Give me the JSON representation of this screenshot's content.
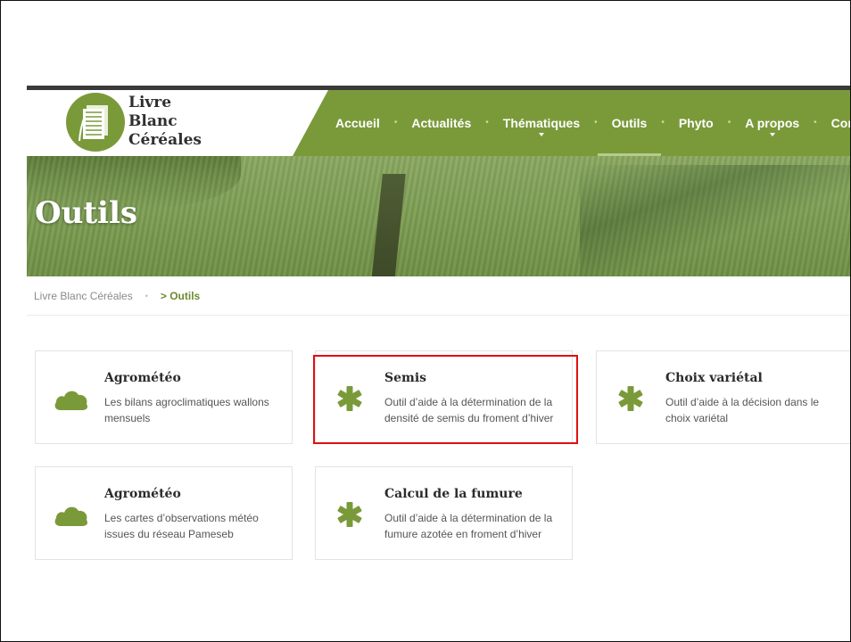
{
  "logo": {
    "lines": [
      "Livre",
      "Blanc",
      "Céréales"
    ]
  },
  "nav": {
    "items": [
      {
        "label": "Accueil",
        "dropdown": false,
        "active": false
      },
      {
        "label": "Actualités",
        "dropdown": false,
        "active": false
      },
      {
        "label": "Thématiques",
        "dropdown": true,
        "active": false
      },
      {
        "label": "Outils",
        "dropdown": false,
        "active": true
      },
      {
        "label": "Phyto",
        "dropdown": false,
        "active": false
      },
      {
        "label": "A propos",
        "dropdown": true,
        "active": false
      },
      {
        "label": "Contact",
        "dropdown": false,
        "active": false
      }
    ]
  },
  "hero": {
    "title": "Outils"
  },
  "breadcrumb": {
    "home": "Livre Blanc Céréales",
    "current": "> Outils"
  },
  "cards": [
    {
      "icon": "cloud-icon",
      "title": "Agrométéo",
      "desc": "Les bilans agroclimatiques wallons mensuels"
    },
    {
      "icon": "asterisk-icon",
      "title": "Semis",
      "desc": "Outil d’aide à la détermination de la densité de semis du froment d’hiver"
    },
    {
      "icon": "asterisk-icon",
      "title": "Choix variétal",
      "desc": "Outil d’aide à la décision dans le choix variétal"
    },
    {
      "icon": "cloud-icon",
      "title": "Agrométéo",
      "desc": "Les cartes d’observations météo issues du réseau Pameseb"
    },
    {
      "icon": "asterisk-icon",
      "title": "Calcul de la fumure",
      "desc": "Outil d’aide à la détermination de la fumure azotée en froment d’hiver"
    }
  ],
  "colors": {
    "brand": "#7a9a3a",
    "highlight": "#e01010",
    "active_crumb": "#6d8a2f"
  }
}
